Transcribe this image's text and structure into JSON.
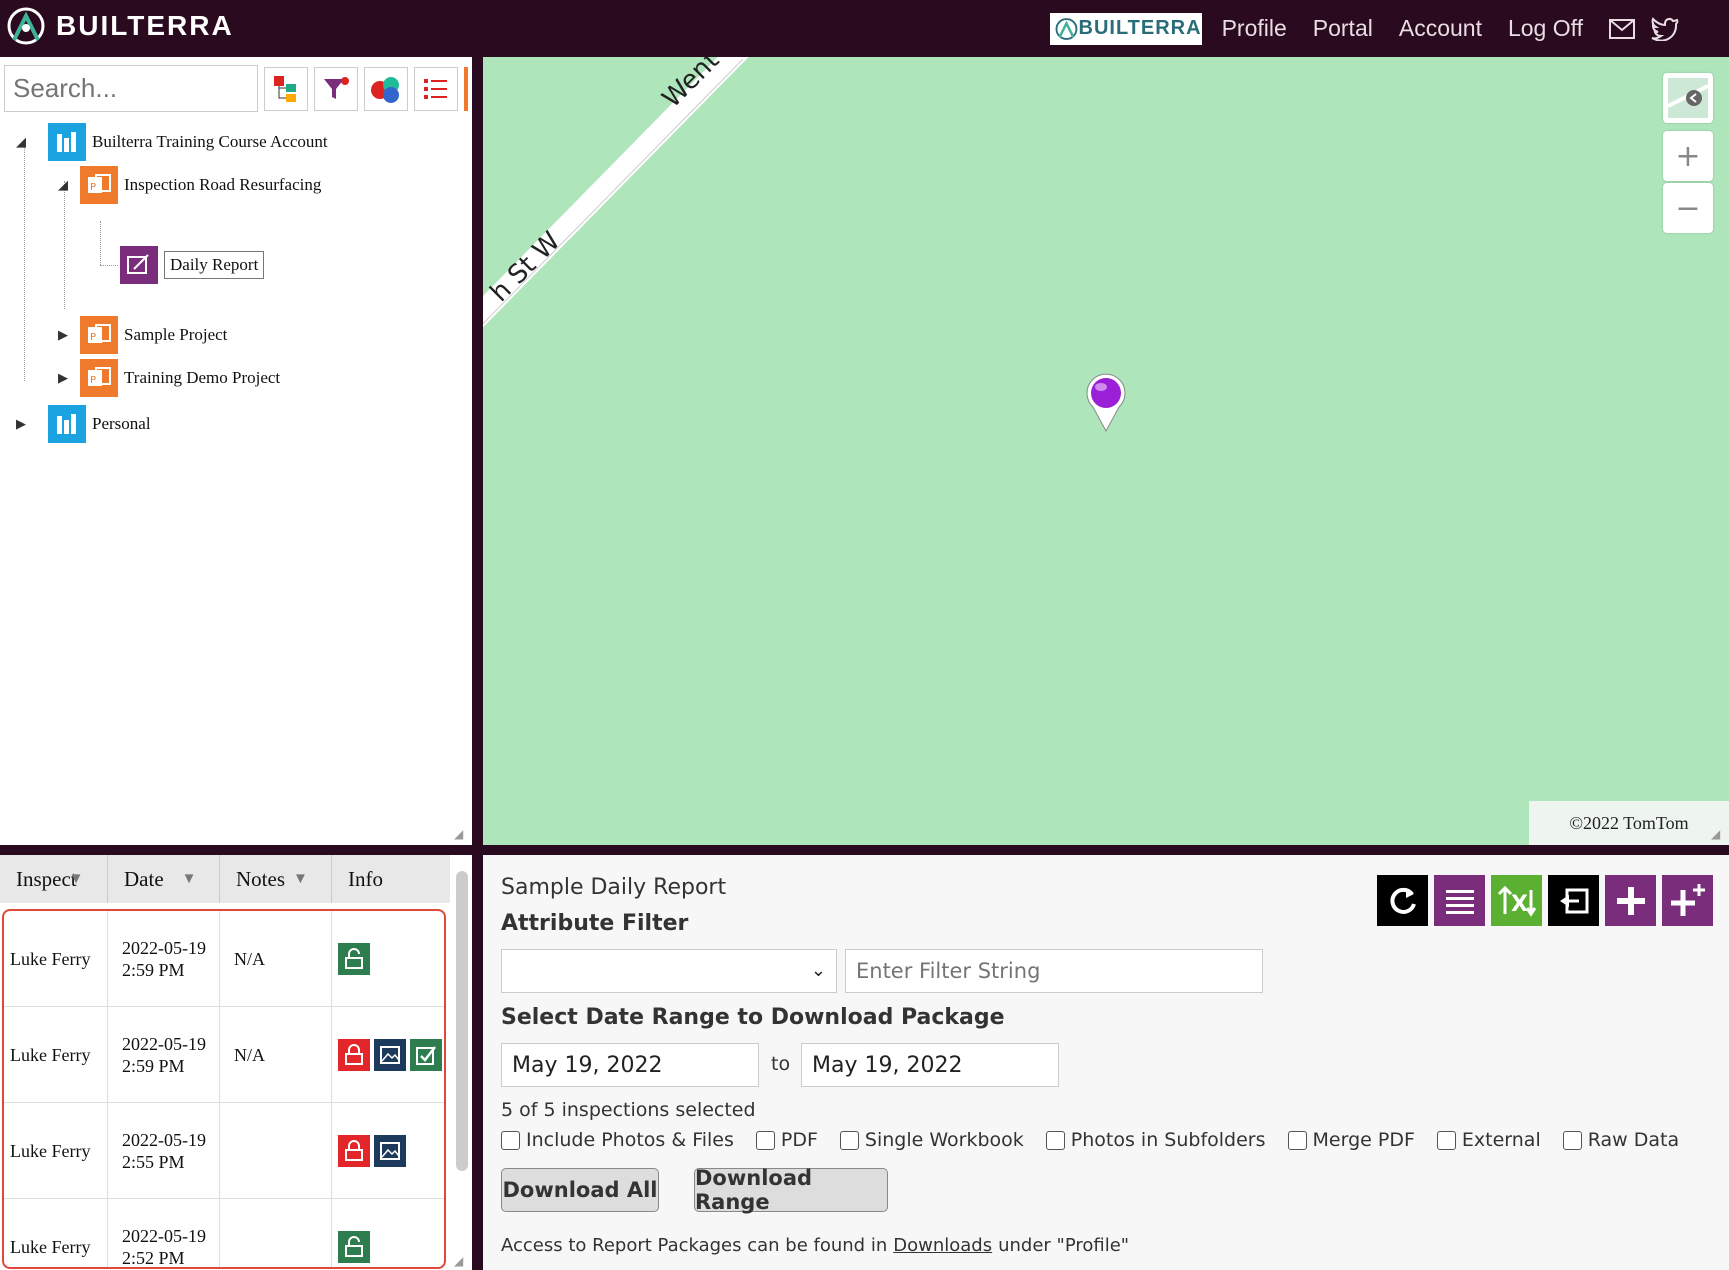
{
  "header": {
    "brand": "BUILTERRA",
    "mini_logo": "BUILTERRA",
    "nav": [
      "Profile",
      "Portal",
      "Account",
      "Log Off"
    ],
    "icons": [
      "mail-icon",
      "twitter-icon"
    ]
  },
  "search": {
    "placeholder": "Search..."
  },
  "tree": {
    "root1": "Builterra Training Course Account",
    "child1": "Inspection Road Resurfacing",
    "grandchild1": "Daily Report",
    "child2": "Sample Project",
    "child3": "Training Demo Project",
    "root2": "Personal"
  },
  "map": {
    "street1": "Went",
    "street2": "h St W",
    "attribution": "©2022 TomTom",
    "colors": {
      "land": "#aee5bb",
      "marker": "#9a1fd6"
    }
  },
  "grid": {
    "headers": [
      "Inspect",
      "Date",
      "Notes",
      "Info"
    ],
    "rows": [
      {
        "inspector": "Luke Ferry",
        "date": "2022-05-19 2:59 PM",
        "notes": "N/A"
      },
      {
        "inspector": "Luke Ferry",
        "date": "2022-05-19 2:59 PM",
        "notes": "N/A"
      },
      {
        "inspector": "Luke Ferry",
        "date": "2022-05-19 2:55 PM",
        "notes": ""
      },
      {
        "inspector": "Luke Ferry",
        "date": "2022-05-19 2:52 PM",
        "notes": ""
      }
    ]
  },
  "report": {
    "title": "Sample Daily Report",
    "attribute_filter": "Attribute Filter",
    "filter_placeholder": "Enter Filter String",
    "date_range_heading": "Select Date Range to Download Package",
    "date_from": "May 19, 2022",
    "to": "to",
    "date_to": "May 19, 2022",
    "selected_count": "5 of 5 inspections selected",
    "options": [
      "Include Photos & Files",
      "PDF",
      "Single Workbook",
      "Photos in Subfolders",
      "Merge PDF",
      "External",
      "Raw Data"
    ],
    "download_all": "Download All",
    "download_range": "Download Range",
    "access_prefix": "Access to Report Packages can be found in",
    "access_link": "Downloads",
    "access_suffix": "under \"Profile\""
  }
}
